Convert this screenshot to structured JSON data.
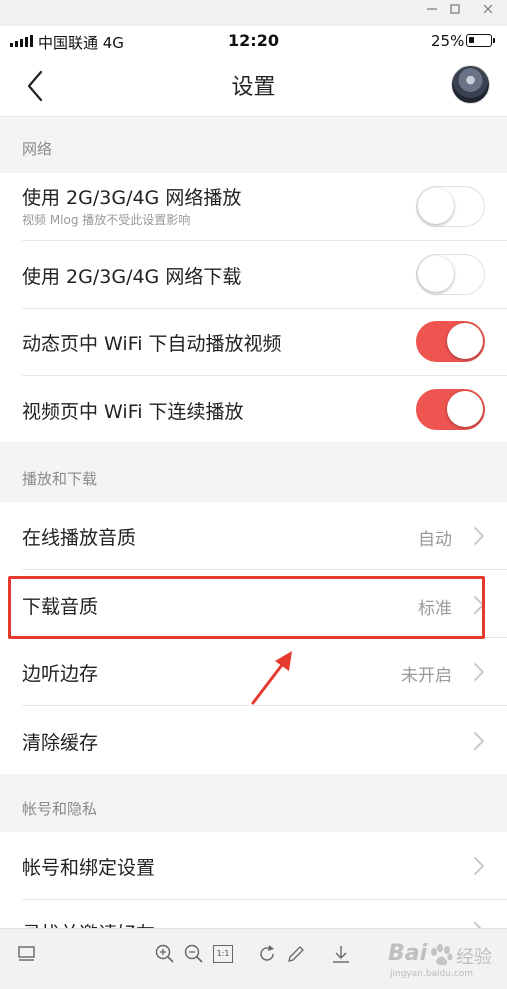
{
  "status_bar": {
    "carrier": "中国联通  4G",
    "time": "12:20",
    "battery_percent": "25%",
    "battery_level": 0.25
  },
  "nav": {
    "title": "设置",
    "back_icon": "chevron-left-icon",
    "avatar_icon": "user-avatar"
  },
  "sections": {
    "network": {
      "header": "网络",
      "rows": [
        {
          "title": "使用 2G/3G/4G 网络播放",
          "subtitle": "视频 Mlog 播放不受此设置影响",
          "toggle": false
        },
        {
          "title": "使用 2G/3G/4G 网络下载",
          "toggle": false
        },
        {
          "title": "动态页中 WiFi 下自动播放视频",
          "toggle": true
        },
        {
          "title": "视频页中 WiFi 下连续播放",
          "toggle": true
        }
      ]
    },
    "playback": {
      "header": "播放和下载",
      "rows": [
        {
          "title": "在线播放音质",
          "value": "自动"
        },
        {
          "title": "下载音质",
          "value": "标准"
        },
        {
          "title": "边听边存",
          "value": "未开启"
        },
        {
          "title": "清除缓存",
          "value": ""
        }
      ]
    },
    "privacy": {
      "header": "帐号和隐私",
      "rows": [
        {
          "title": "帐号和绑定设置"
        },
        {
          "title": "寻找并邀请好友"
        }
      ]
    }
  },
  "toolbar": {
    "icons": [
      "layout-icon",
      "zoom-in-icon",
      "zoom-out-icon",
      "actual-size-icon",
      "rotate-icon",
      "edit-icon",
      "download-icon"
    ],
    "actual_size_label": "1:1"
  },
  "watermark": {
    "brand": "Bai",
    "sub": "经验",
    "url": "jingyan.baidu.com"
  },
  "colors": {
    "accent": "#ee5450",
    "highlight": "#e63a2e",
    "section_bg": "#f4f4f4"
  }
}
